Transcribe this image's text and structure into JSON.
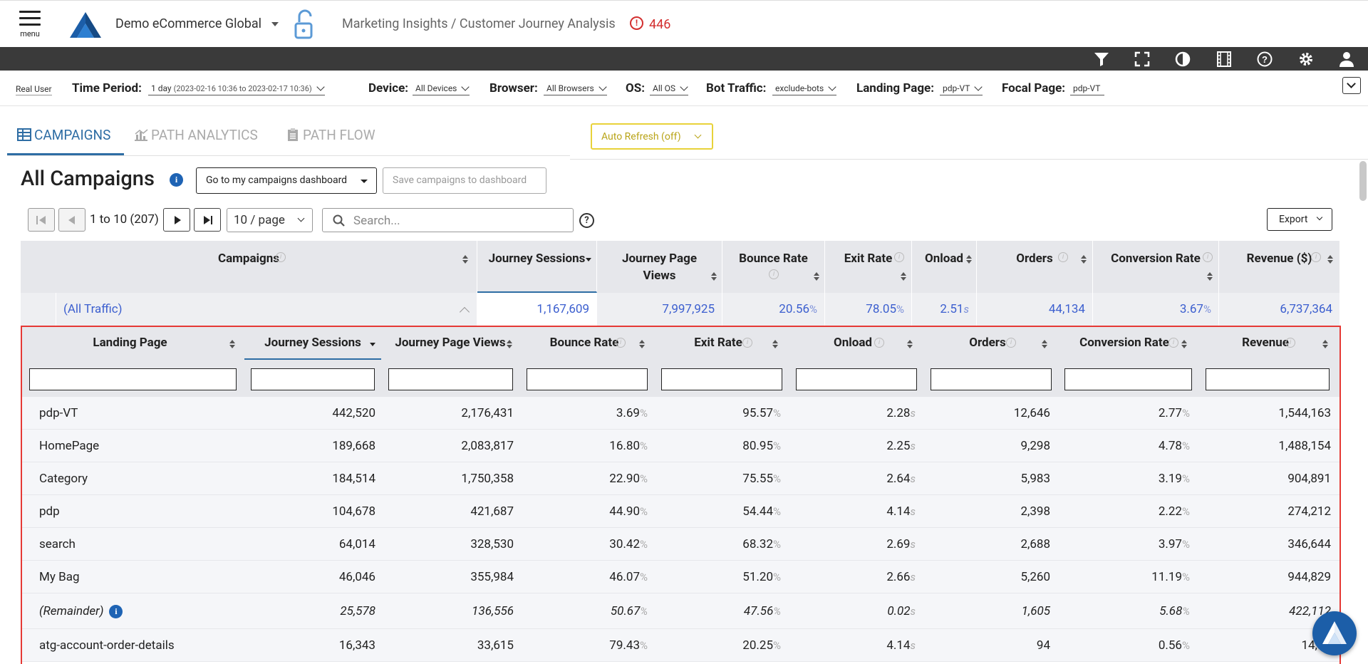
{
  "header": {
    "menu_label": "menu",
    "org_name": "Demo eCommerce Global",
    "breadcrumb": "Marketing Insights / Customer Journey Analysis",
    "alert_count": "446"
  },
  "toolbar_icons": [
    "filter-icon",
    "fullscreen-icon",
    "contrast-icon",
    "film-icon",
    "help-icon",
    "gear-icon",
    "user-icon"
  ],
  "filters": {
    "real_user": "Real User",
    "time_period": {
      "label": "Time Period:",
      "value": "1 day",
      "range": "(2023-02-16 10:36 to 2023-02-17 10:36)"
    },
    "device": {
      "label": "Device:",
      "value": "All Devices"
    },
    "browser": {
      "label": "Browser:",
      "value": "All Browsers"
    },
    "os": {
      "label": "OS:",
      "value": "All OS"
    },
    "bot": {
      "label": "Bot Traffic:",
      "value": "exclude-bots"
    },
    "landing": {
      "label": "Landing Page:",
      "value": "pdp-VT"
    },
    "focal": {
      "label": "Focal Page:",
      "value": "pdp-VT"
    }
  },
  "tabs": [
    {
      "label": "CAMPAIGNS",
      "active": true
    },
    {
      "label": "PATH ANALYTICS",
      "active": false
    },
    {
      "label": "PATH FLOW",
      "active": false
    }
  ],
  "auto_refresh": "Auto Refresh (off)",
  "page_title": "All Campaigns",
  "buttons": {
    "goto": "Go to my campaigns dashboard",
    "save": "Save campaigns to dashboard",
    "export": "Export"
  },
  "pagination": {
    "range": "1 to 10 (207)",
    "page_size": "10 / page",
    "search_placeholder": "Search..."
  },
  "campaigns_table": {
    "columns": [
      "Campaigns",
      "Journey Sessions",
      "Journey Page Views",
      "Bounce Rate",
      "Exit Rate",
      "Onload",
      "Orders",
      "Conversion Rate",
      "Revenue ($)"
    ],
    "all_traffic": {
      "name": "(All Traffic)",
      "sessions": "1,167,609",
      "page_views": "7,997,925",
      "bounce": "20.56",
      "exit": "78.05",
      "onload": "2.51",
      "orders": "44,134",
      "conversion": "3.67",
      "revenue": "6,737,364"
    }
  },
  "landing_table": {
    "columns": [
      "Landing Page",
      "Journey Sessions",
      "Journey Page Views",
      "Bounce Rate",
      "Exit Rate",
      "Onload",
      "Orders",
      "Conversion Rate",
      "Revenue"
    ],
    "rows": [
      {
        "name": "pdp-VT",
        "sessions": "442,520",
        "page_views": "2,176,431",
        "bounce": "3.69",
        "exit": "95.57",
        "onload": "2.28",
        "orders": "12,646",
        "conversion": "2.77",
        "revenue": "1,544,163"
      },
      {
        "name": "HomePage",
        "sessions": "189,668",
        "page_views": "2,083,817",
        "bounce": "16.80",
        "exit": "80.95",
        "onload": "2.25",
        "orders": "9,298",
        "conversion": "4.78",
        "revenue": "1,488,154"
      },
      {
        "name": "Category",
        "sessions": "184,514",
        "page_views": "1,750,358",
        "bounce": "22.90",
        "exit": "75.55",
        "onload": "2.64",
        "orders": "5,983",
        "conversion": "3.19",
        "revenue": "904,891"
      },
      {
        "name": "pdp",
        "sessions": "104,678",
        "page_views": "421,687",
        "bounce": "44.90",
        "exit": "54.44",
        "onload": "4.14",
        "orders": "2,398",
        "conversion": "2.22",
        "revenue": "274,212"
      },
      {
        "name": "search",
        "sessions": "64,014",
        "page_views": "328,530",
        "bounce": "30.42",
        "exit": "68.32",
        "onload": "2.69",
        "orders": "2,688",
        "conversion": "3.97",
        "revenue": "346,644"
      },
      {
        "name": "My Bag",
        "sessions": "46,046",
        "page_views": "355,984",
        "bounce": "46.07",
        "exit": "51.20",
        "onload": "2.66",
        "orders": "5,260",
        "conversion": "11.19",
        "revenue": "944,829"
      },
      {
        "name": "(Remainder)",
        "sessions": "25,578",
        "page_views": "136,556",
        "bounce": "50.67",
        "exit": "47.56",
        "onload": "0.02",
        "orders": "1,605",
        "conversion": "5.68",
        "revenue": "422,112"
      },
      {
        "name": "atg-account-order-details",
        "sessions": "16,343",
        "page_views": "33,615",
        "bounce": "79.43",
        "exit": "20.25",
        "onload": "4.14",
        "orders": "94",
        "conversion": "0.56",
        "revenue": "14,73"
      }
    ]
  },
  "units": {
    "pct": "%",
    "sec": "s"
  }
}
